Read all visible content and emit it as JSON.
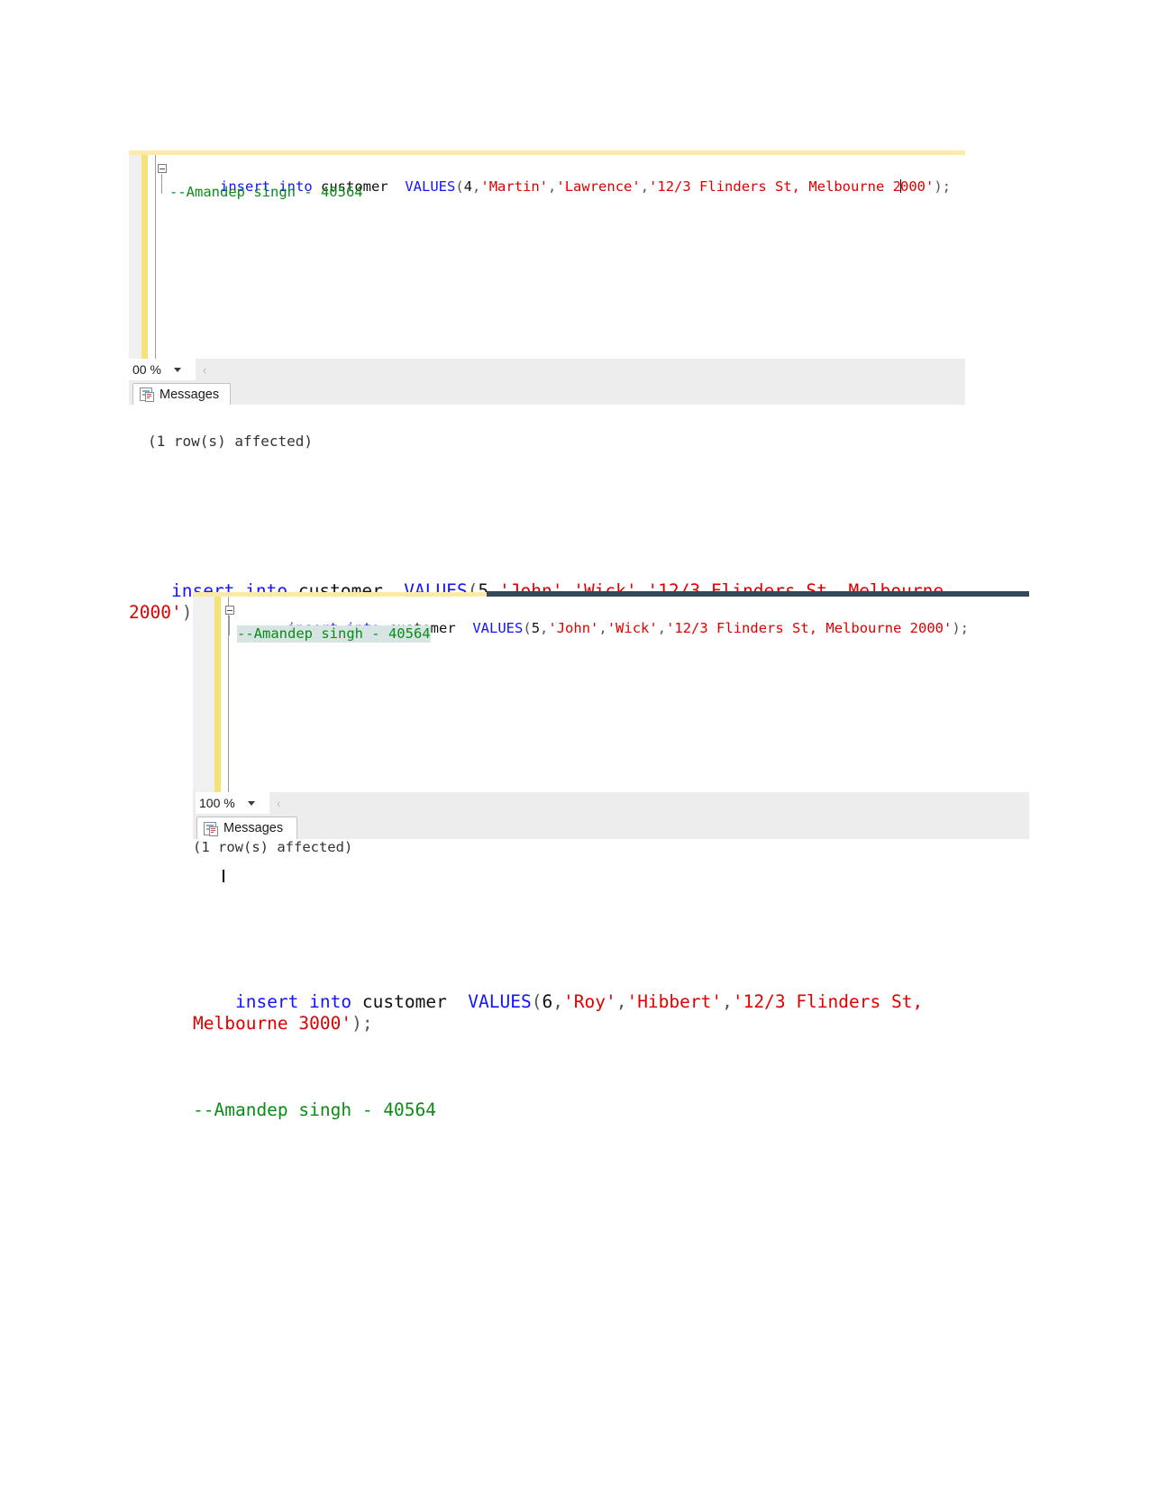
{
  "document": {
    "block_middle": {
      "line1": {
        "kw1": "insert",
        "kw2": "into",
        "table": "customer",
        "kw3": "VALUES",
        "open": "(",
        "id": "5",
        "comma1": ",",
        "first": "'John'",
        "comma2": ",",
        "last": "'Wick'",
        "comma3": ",",
        "address": "'12/3 Flinders St, Melbourne 2000'",
        "close": ");"
      },
      "comment": "--Amandep singh — 40564"
    },
    "block_bottom": {
      "line1": {
        "kw1": "insert",
        "kw2": "into",
        "table": "customer",
        "kw3": "VALUES",
        "open": "(",
        "id": "6",
        "comma1": ",",
        "first": "'Roy'",
        "comma2": ",",
        "last": "'Hibbert'",
        "comma3": ",",
        "address": "'12/3 Flinders St, Melbourne 3000'",
        "close": ");"
      },
      "comment": "--Amandep singh - 40564"
    }
  },
  "panel_top": {
    "editor": {
      "line1": {
        "kw1": "insert",
        "kw2": "into",
        "table": "customer",
        "kw3": "VALUES",
        "open": "(",
        "id": "4",
        "comma1": ",",
        "first": "'Martin'",
        "comma2": ",",
        "last": "'Lawrence'",
        "comma3": ",",
        "address_a": "'12/3 Flinders St, Melbourne 2",
        "address_b": "000'",
        "close": ");"
      },
      "line2_comment": "--Amandep singh - 40564"
    },
    "status": {
      "zoom_level": "00 %"
    },
    "results": {
      "tab_label": "Messages",
      "tab_icon": "messages-icon",
      "message": "(1 row(s) affected)"
    }
  },
  "panel_bottom": {
    "editor": {
      "line1": {
        "kw1": "insert",
        "kw2": "into",
        "table": "customer",
        "kw3": "VALUES",
        "open": "(",
        "id": "5",
        "comma1": ",",
        "first": "'John'",
        "comma2": ",",
        "last": "'Wick'",
        "comma3": ",",
        "address": "'12/3 Flinders St, Melbourne 2000'",
        "close": ");"
      },
      "line2_comment": "--Amandep singh - 40564"
    },
    "status": {
      "zoom_level": "100 %"
    },
    "results": {
      "tab_label": "Messages",
      "tab_icon": "messages-icon",
      "message": "(1 row(s) affected)"
    }
  },
  "colors": {
    "keyword": "#1414ff",
    "string": "#e00000",
    "comment": "#0a8c17",
    "gutter_yellow": "#f5e37a",
    "chrome_grey": "#ededed",
    "selection": "#d6e4e4",
    "topbar_dark": "#34495a"
  }
}
